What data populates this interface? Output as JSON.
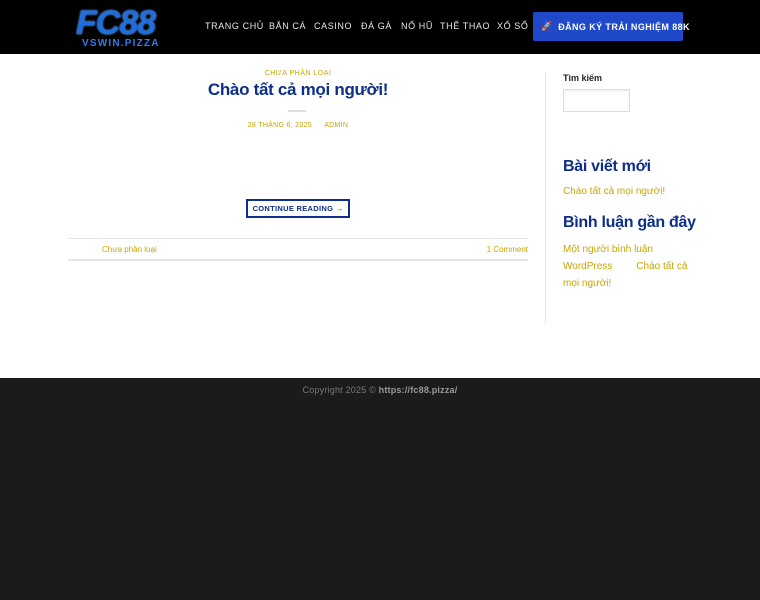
{
  "header": {
    "logo_main": "FC88",
    "logo_sub": "VSWIN.PIZZA",
    "nav": [
      "TRANG CHỦ",
      "BẮN CÁ",
      "CASINO",
      "ĐÁ GÀ",
      "NỔ HŨ",
      "THỂ THAO",
      "XỔ SỐ"
    ],
    "cta_icon": "rocket-icon",
    "cta_label": "ĐĂNG KÝ TRẢI NGHIỆM 88K"
  },
  "post": {
    "category_top": "CHƯA PHÂN LOẠI",
    "title": "Chào tất cả mọi người!",
    "date": "28 THÁNG 6, 2025",
    "author": "ADMIN",
    "continue_label": "CONTINUE READING →",
    "category_footer": "Chưa phân loại",
    "comments": "1 Comment"
  },
  "sidebar": {
    "search_label": "Tìm kiếm",
    "search_value": "",
    "recent_title": "Bài viết mới",
    "recent_link": "Chào tất cả mọi người!",
    "comments_title": "Bình luận gần đây",
    "comment_author": "Một người bình luận WordPress",
    "comment_post": "Chào tất cả mọi người!"
  },
  "footer": {
    "copyright_prefix": "Copyright 2025 ©",
    "copyright_site": "https://fc88.pizza/"
  },
  "colors": {
    "header_bg": "#000000",
    "accent_gold": "#c8a500",
    "title_blue": "#0d2e8a",
    "cta_blue": "#1f49c9",
    "footer_bg": "#1b1b1b"
  }
}
